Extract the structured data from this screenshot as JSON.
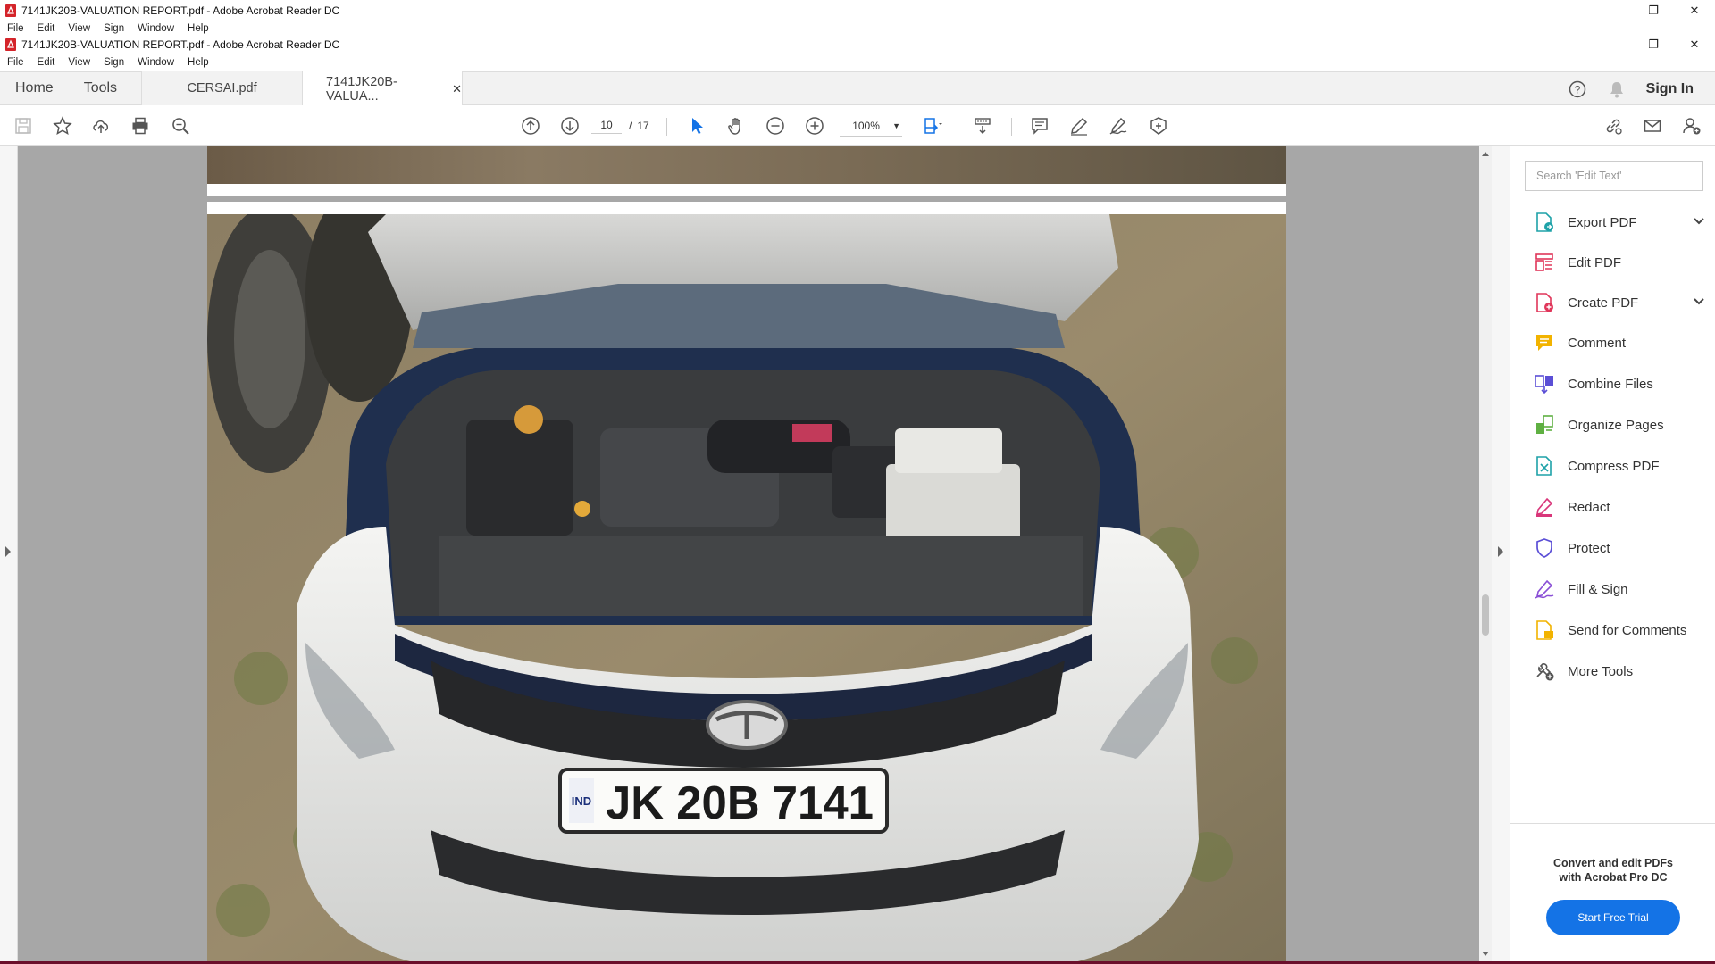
{
  "window_outer": {
    "title": "7141JK20B-VALUATION REPORT.pdf - Adobe Acrobat Reader DC",
    "menu": [
      "File",
      "Edit",
      "View",
      "Sign",
      "Window",
      "Help"
    ]
  },
  "window_inner": {
    "title": "7141JK20B-VALUATION REPORT.pdf - Adobe Acrobat Reader DC",
    "menu": [
      "File",
      "Edit",
      "View",
      "Sign",
      "Window",
      "Help"
    ]
  },
  "window_controls": {
    "minimize": "—",
    "restore": "❐",
    "close": "✕"
  },
  "tabs": {
    "home": "Home",
    "tools": "Tools",
    "documents": [
      {
        "label": "CERSAI.pdf",
        "active": false
      },
      {
        "label": "7141JK20B-VALUA...",
        "active": true
      }
    ],
    "close_glyph": "✕",
    "sign_in": "Sign In"
  },
  "toolbar": {
    "current_page": "10",
    "page_separator": "/",
    "total_pages": "17",
    "zoom": "100%"
  },
  "document": {
    "license_plate": "JK 20B 7141",
    "plate_country": "IND"
  },
  "tools_pane": {
    "search_placeholder": "Search 'Edit Text'",
    "items": [
      {
        "label": "Export PDF",
        "icon": "export-pdf-icon",
        "color": "#1ea2a8",
        "expandable": true
      },
      {
        "label": "Edit PDF",
        "icon": "edit-pdf-icon",
        "color": "#e0365a",
        "expandable": false
      },
      {
        "label": "Create PDF",
        "icon": "create-pdf-icon",
        "color": "#e0365a",
        "expandable": true
      },
      {
        "label": "Comment",
        "icon": "comment-icon",
        "color": "#f2b300",
        "expandable": false
      },
      {
        "label": "Combine Files",
        "icon": "combine-files-icon",
        "color": "#5b4fd6",
        "expandable": false
      },
      {
        "label": "Organize Pages",
        "icon": "organize-pages-icon",
        "color": "#5fb042",
        "expandable": false
      },
      {
        "label": "Compress PDF",
        "icon": "compress-pdf-icon",
        "color": "#1ea2a8",
        "expandable": false
      },
      {
        "label": "Redact",
        "icon": "redact-icon",
        "color": "#d9367a",
        "expandable": false
      },
      {
        "label": "Protect",
        "icon": "protect-icon",
        "color": "#5b4fd6",
        "expandable": false
      },
      {
        "label": "Fill & Sign",
        "icon": "fill-sign-icon",
        "color": "#8a4fd6",
        "expandable": false
      },
      {
        "label": "Send for Comments",
        "icon": "send-for-comments-icon",
        "color": "#f2b300",
        "expandable": false
      },
      {
        "label": "More Tools",
        "icon": "more-tools-icon",
        "color": "#555555",
        "expandable": false
      }
    ],
    "promo_line1": "Convert and edit PDFs",
    "promo_line2": "with Acrobat Pro DC",
    "trial_button": "Start Free Trial"
  },
  "colors": {
    "accent": "#1473e6",
    "doc_background": "#a7a7a7",
    "taskbar_accent": "#6b0f2b"
  }
}
